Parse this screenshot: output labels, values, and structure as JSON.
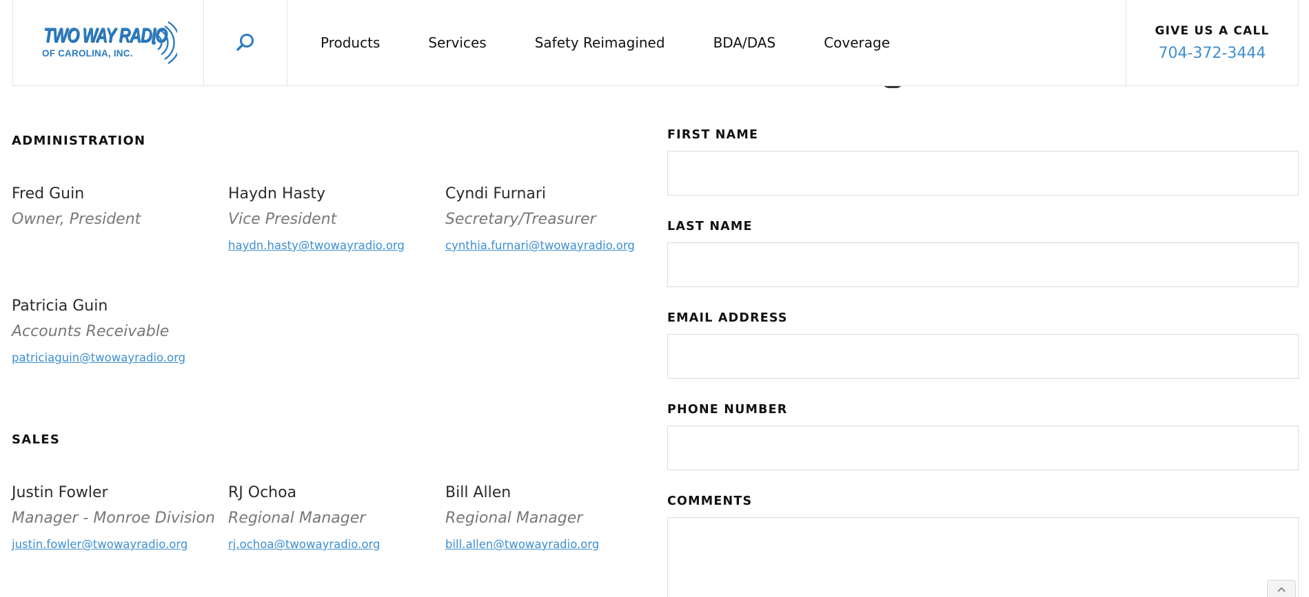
{
  "header": {
    "logo": {
      "line1": "TWO WAY RADIO",
      "line2": "OF CAROLINA, INC."
    },
    "nav": [
      "Products",
      "Services",
      "Safety Reimagined",
      "BDA/DAS",
      "Coverage"
    ],
    "call": {
      "label": "GIVE US A CALL",
      "phone": "704-372-3444"
    }
  },
  "sections": {
    "administration": {
      "heading": "ADMINISTRATION",
      "people": [
        {
          "name": "Fred Guin",
          "title": "Owner, President",
          "email": ""
        },
        {
          "name": "Haydn Hasty",
          "title": "Vice President",
          "email": "haydn.hasty@twowayradio.org"
        },
        {
          "name": "Cyndi Furnari",
          "title": "Secretary/Treasurer",
          "email": "cynthia.furnari@twowayradio.org"
        },
        {
          "name": "Patricia Guin",
          "title": "Accounts Receivable",
          "email": "patriciaguin@twowayradio.org"
        }
      ]
    },
    "sales": {
      "heading": "SALES",
      "people": [
        {
          "name": "Justin Fowler",
          "title": "Manager - Monroe Division",
          "email": "justin.fowler@twowayradio.org"
        },
        {
          "name": "RJ Ochoa",
          "title": "Regional Manager",
          "email": "rj.ochoa@twowayradio.org"
        },
        {
          "name": "Bill Allen",
          "title": "Regional Manager",
          "email": "bill.allen@twowayradio.org"
        }
      ]
    }
  },
  "form": {
    "first_name": {
      "label": "FIRST NAME",
      "value": ""
    },
    "last_name": {
      "label": "LAST NAME",
      "value": ""
    },
    "email": {
      "label": "EMAIL ADDRESS",
      "value": ""
    },
    "phone": {
      "label": "PHONE NUMBER",
      "value": ""
    },
    "comments": {
      "label": "COMMENTS",
      "value": ""
    }
  },
  "icons": {
    "search": "search-icon",
    "scroll_top": "chevron-up-icon"
  },
  "colors": {
    "accent": "#3d8fd0",
    "logo_blue": "#2b7bc0",
    "text": "#222222",
    "muted": "#777777",
    "border": "#e3e3e3"
  }
}
